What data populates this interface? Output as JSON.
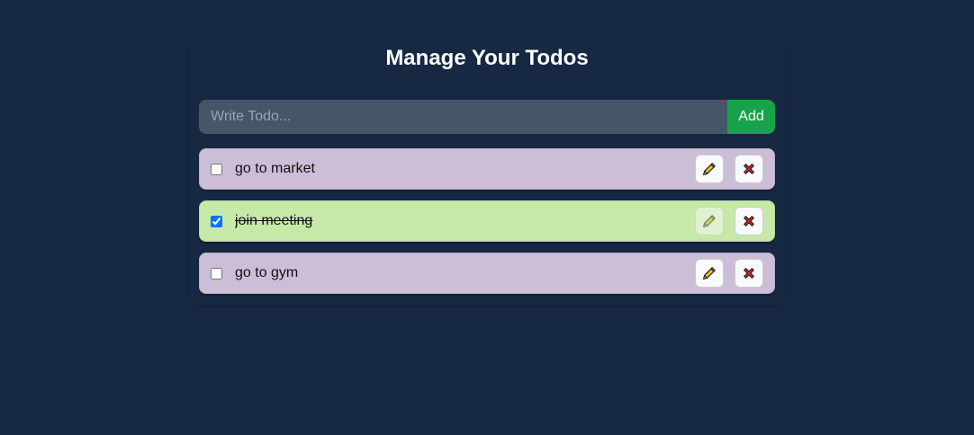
{
  "header": {
    "title": "Manage Your Todos"
  },
  "form": {
    "input_placeholder": "Write Todo...",
    "input_value": "",
    "add_label": "Add"
  },
  "todos": [
    {
      "text": "go to market",
      "completed": false,
      "edit_icon": "pencil-icon",
      "delete_icon": "close-icon"
    },
    {
      "text": "join meeting",
      "completed": true,
      "edit_icon": "pencil-icon",
      "delete_icon": "close-icon"
    },
    {
      "text": "go to gym",
      "completed": false,
      "edit_icon": "pencil-icon",
      "delete_icon": "close-icon"
    }
  ],
  "colors": {
    "background": "#172842",
    "input_bg": "#475569",
    "add_button": "#16a34a",
    "pending_item": "#ccbed7",
    "completed_item": "#c6e9a7",
    "delete_icon": "#c0262d",
    "edit_icon": "#f5c518"
  }
}
